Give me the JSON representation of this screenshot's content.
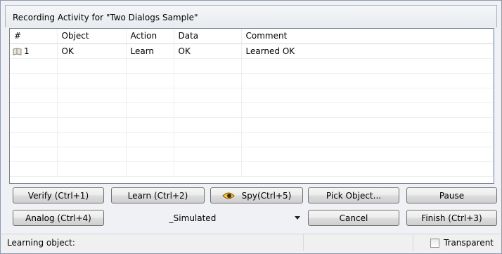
{
  "window": {
    "title": "Recording Activity for \"Two Dialogs Sample\""
  },
  "grid": {
    "columns": [
      "#",
      "Object",
      "Action",
      "Data",
      "Comment"
    ],
    "rows": [
      {
        "num": "1",
        "object": "OK",
        "action": "Learn",
        "data": "OK",
        "comment": "Learned OK",
        "icon": "record-icon"
      }
    ]
  },
  "buttons": {
    "verify": "Verify (Ctrl+1)",
    "learn": "Learn (Ctrl+2)",
    "spy": "Spy(Ctrl+5)",
    "pick": "Pick Object...",
    "pause": "Pause",
    "analog": "Analog (Ctrl+4)",
    "cancel": "Cancel",
    "finish": "Finish (Ctrl+3)"
  },
  "mode_dropdown": {
    "value": "_Simulated"
  },
  "status": {
    "text": "Learning object:",
    "transparent_label": "Transparent",
    "transparent_checked": false
  }
}
